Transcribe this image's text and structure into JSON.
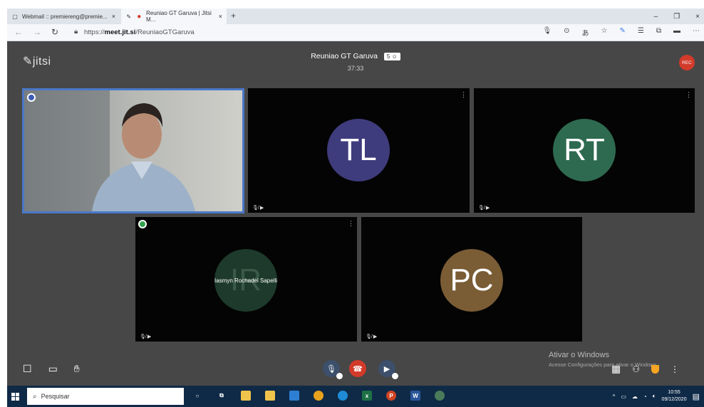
{
  "browser": {
    "tabs": [
      {
        "title": "Webmail :: premiereng@premie...",
        "close": "×"
      },
      {
        "title": "Reuniao GT Garuva | Jitsi M...",
        "close": "×"
      }
    ],
    "new_tab": "+",
    "window_controls": {
      "minimize": "–",
      "maximize": "❐",
      "close": "×"
    },
    "url_prefix": "https://",
    "url_host": "meet.jit.si",
    "url_path": "/ReuniaoGTGaruva"
  },
  "meeting": {
    "logo": "jitsi",
    "title": "Reuniao GT Garuva",
    "participants_count": "5",
    "timer": "37:33",
    "rec_label": "REC"
  },
  "participants": [
    {
      "initials": "",
      "color": "#3b5bb5"
    },
    {
      "initials": "TL",
      "color": "#3f3c7d"
    },
    {
      "initials": "RT",
      "color": "#2e6a4f"
    },
    {
      "initials": "IR",
      "color": "#1d3a2c",
      "display_name": "Iasmyn Rochadel Sapelli"
    },
    {
      "initials": "PC",
      "color": "#7a5c35"
    }
  ],
  "activation": {
    "title": "Ativar o Windows",
    "subtitle": "Acesse Configurações para ativar o Windows."
  },
  "taskbar": {
    "search_placeholder": "Pesquisar",
    "time": "10:55",
    "date": "09/12/2020"
  }
}
